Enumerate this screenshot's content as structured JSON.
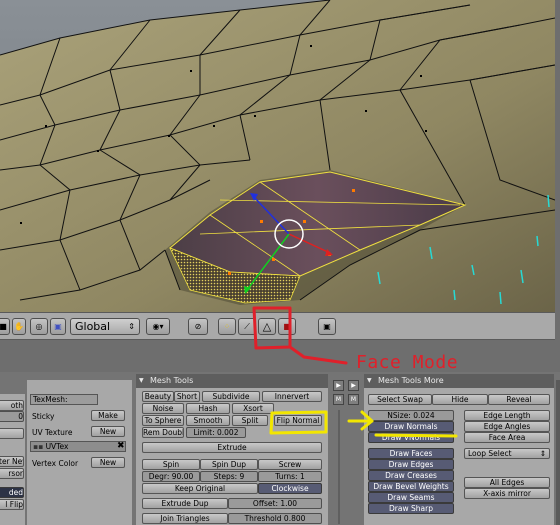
{
  "header3d": {
    "orientation": "Global",
    "icons": [
      "layer-icon",
      "solid-icon",
      "box-icon",
      "pivot-icon",
      "hand-icon",
      "snap-icon",
      "vertex-select-icon",
      "edge-select-icon",
      "face-select-icon",
      "occlude-icon",
      "render-icon"
    ]
  },
  "annotation": {
    "label": "Face Mode",
    "colors": {
      "red": "#e0202a",
      "yellow": "#f2e600"
    }
  },
  "side_strip": {
    "a": "▶",
    "b": "▶",
    "m1": "M",
    "m2": "M"
  },
  "left_partial": {
    "items": [
      "oth",
      "0",
      "",
      "ter New",
      "rsor",
      "ded",
      "l Flip"
    ]
  },
  "uv_panel": {
    "texmesh_label": "TexMesh:",
    "sticky_label": "Sticky",
    "make_label": "Make",
    "uv_texture_label": "UV Texture",
    "new1_label": "New",
    "uvtex_value": "UVTex",
    "close_glyph": "✖",
    "vertex_color_label": "Vertex Color",
    "new2_label": "New"
  },
  "mesh_tools": {
    "title": "Mesh Tools",
    "row1": [
      "Beauty",
      "Short",
      "Subdivide",
      "Innervert"
    ],
    "row2": [
      "Noise",
      "Hash",
      "Xsort"
    ],
    "row3": [
      "To Sphere",
      "Smooth",
      "Split",
      "Flip Normal"
    ],
    "rem_doubles": "Rem Doubl",
    "limit": "Limit: 0.002",
    "threshold_label": "Threshold 0.800",
    "extrude": "Extrude",
    "spin": "Spin",
    "spin_dup": "Spin Dup",
    "screw": "Screw",
    "degr": "Degr: 90.00",
    "steps": "Steps: 9",
    "turns": "Turns: 1",
    "keep_original": "Keep Original",
    "clockwise": "Clockwise",
    "extrude_dup": "Extrude Dup",
    "offset": "Offset: 1.00",
    "join_triangles": "Join Triangles"
  },
  "mesh_tools_more": {
    "title": "Mesh Tools More",
    "select_swap": "Select Swap",
    "hide": "Hide",
    "reveal": "Reveal",
    "nsize": "NSize: 0.024",
    "draw_normals": "Draw Normals",
    "draw_vnormals": "Draw VNormals",
    "edge_length": "Edge Length",
    "edge_angles": "Edge Angles",
    "face_area": "Face Area",
    "loop_select": "Loop Select",
    "draw_faces": "Draw Faces",
    "draw_edges": "Draw Edges",
    "draw_creases": "Draw Creases",
    "draw_bevel_weights": "Draw Bevel Weights",
    "draw_seams": "Draw Seams",
    "draw_sharp": "Draw Sharp",
    "all_edges": "All Edges",
    "x_axis_mirror": "X-axis mirror"
  }
}
